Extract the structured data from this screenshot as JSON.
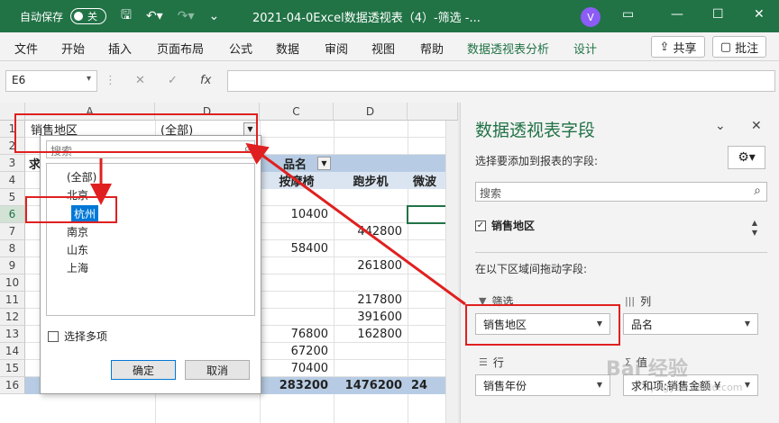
{
  "titlebar": {
    "autosave_label": "自动保存",
    "autosave_state": "关",
    "title": "2021-04-0Excel数据透视表（4）-筛选 -...",
    "avatar": "V"
  },
  "ribbon": {
    "tabs": [
      "文件",
      "开始",
      "插入",
      "页面布局",
      "公式",
      "数据",
      "审阅",
      "视图",
      "帮助",
      "数据透视表分析",
      "设计"
    ],
    "share": "共享",
    "comment": "批注"
  },
  "formula_bar": {
    "name_box": "E6",
    "formula": ""
  },
  "grid": {
    "columns": [
      "A",
      "D",
      "C",
      "D"
    ],
    "rows": [
      "1",
      "2",
      "3",
      "4",
      "5",
      "6",
      "7",
      "8",
      "9",
      "10",
      "11",
      "12",
      "13",
      "14",
      "15",
      "16"
    ],
    "selected_row": "6",
    "filter_label": "销售地区",
    "filter_value": "(全部)",
    "col_field_label": "品名",
    "row3_a": "求",
    "headers": [
      "按摩椅",
      "跑步机",
      "微波"
    ],
    "col_c_values": {
      "6": "10400",
      "8": "58400",
      "13": "76800",
      "14": "67200",
      "15": "70400"
    },
    "col_d_values": {
      "7": "442800",
      "9": "261800",
      "11": "217800",
      "12": "391600",
      "13": "162800"
    },
    "totals": {
      "c": "283200",
      "d": "1476200",
      "e": "24"
    }
  },
  "popup": {
    "search_placeholder": "搜索",
    "items": [
      "(全部)",
      "北京",
      "杭州",
      "南京",
      "山东",
      "上海"
    ],
    "selected_index": 2,
    "multi_label": "选择多项",
    "ok": "确定",
    "cancel": "取消"
  },
  "pane": {
    "title": "数据透视表字段",
    "hint": "选择要添加到报表的字段:",
    "search_placeholder": "搜索",
    "field": "销售地区",
    "areas_label": "在以下区域间拖动字段:",
    "filter_area_label": "筛选",
    "column_area_label": "列",
    "row_area_label": "行",
    "value_area_label": "值",
    "filter_value": "销售地区",
    "column_value": "品名",
    "row_value": "销售年份",
    "value_value": "求和项:销售金额 ¥"
  },
  "watermark": {
    "main": "Bai 经验",
    "sub": "jingyan.baidu.com"
  },
  "colors": {
    "excel_green": "#217346",
    "annotation_red": "#e02020",
    "selection_blue": "#0078d7"
  }
}
